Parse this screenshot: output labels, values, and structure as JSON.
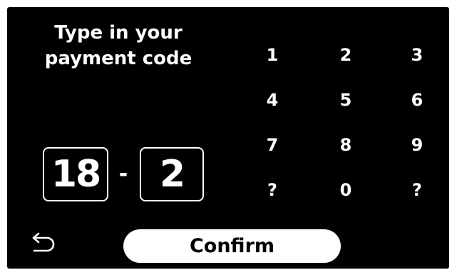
{
  "prompt": {
    "line1": "Type in your",
    "line2": "payment code"
  },
  "code": {
    "part1": "18",
    "separator": "-",
    "part2": "2"
  },
  "keypad": {
    "keys": [
      "1",
      "2",
      "3",
      "4",
      "5",
      "6",
      "7",
      "8",
      "9",
      "?",
      "0",
      "?"
    ]
  },
  "back": {
    "icon": "back-arrow-icon"
  },
  "confirm": {
    "label": "Confirm"
  },
  "colors": {
    "background": "#000000",
    "foreground": "#ffffff",
    "button_text": "#000000"
  }
}
